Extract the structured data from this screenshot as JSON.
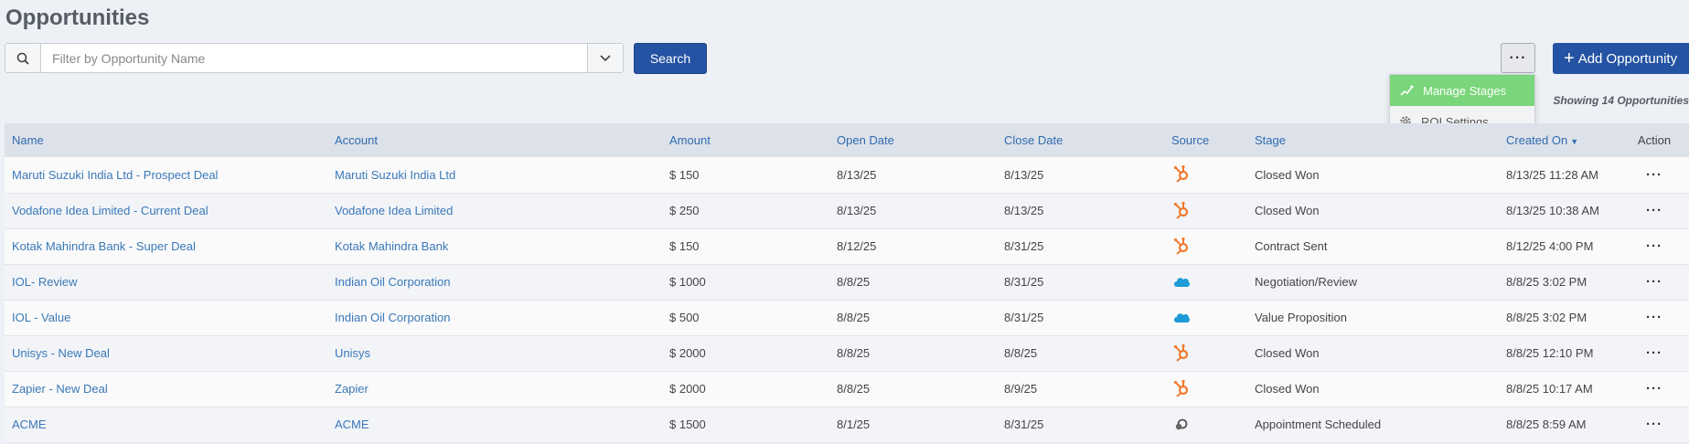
{
  "page": {
    "title": "Opportunities"
  },
  "search": {
    "placeholder": "Filter by Opportunity Name",
    "button_label": "Search"
  },
  "toolbar": {
    "more_label": "···",
    "add_label": "Add Opportunity"
  },
  "menu": {
    "items": [
      {
        "label": "Manage Stages",
        "icon": "stages-icon"
      },
      {
        "label": "ROI Settings",
        "icon": "gear-icon"
      }
    ]
  },
  "summary": {
    "showing": "Showing 14 Opportunities"
  },
  "table": {
    "headers": [
      "Name",
      "Account",
      "Amount",
      "Open Date",
      "Close Date",
      "Source",
      "Stage",
      "Created On",
      "Action"
    ],
    "rows": [
      {
        "name": "Maruti Suzuki India Ltd - Prospect Deal",
        "account": "Maruti Suzuki India Ltd",
        "amount": "$ 150",
        "open": "8/13/25",
        "close": "8/13/25",
        "source": "hubspot-icon",
        "stage": "Closed Won",
        "created": "8/13/25 11:28 AM",
        "action": "···"
      },
      {
        "name": "Vodafone Idea Limited - Current Deal",
        "account": "Vodafone Idea Limited",
        "amount": "$ 250",
        "open": "8/13/25",
        "close": "8/13/25",
        "source": "hubspot-icon",
        "stage": "Closed Won",
        "created": "8/13/25 10:38 AM",
        "action": "···"
      },
      {
        "name": "Kotak Mahindra Bank - Super Deal",
        "account": "Kotak Mahindra Bank",
        "amount": "$ 150",
        "open": "8/12/25",
        "close": "8/31/25",
        "source": "hubspot-icon",
        "stage": "Contract Sent",
        "created": "8/12/25 4:00 PM",
        "action": "···"
      },
      {
        "name": "IOL- Review",
        "account": "Indian Oil Corporation",
        "amount": "$ 1000",
        "open": "8/8/25",
        "close": "8/31/25",
        "source": "salesforce-icon",
        "stage": "Negotiation/Review",
        "created": "8/8/25 3:02 PM",
        "action": "···"
      },
      {
        "name": "IOL - Value",
        "account": "Indian Oil Corporation",
        "amount": "$ 500",
        "open": "8/8/25",
        "close": "8/31/25",
        "source": "salesforce-icon",
        "stage": "Value Proposition",
        "created": "8/8/25 3:02 PM",
        "action": "···"
      },
      {
        "name": "Unisys - New Deal",
        "account": "Unisys",
        "amount": "$ 2000",
        "open": "8/8/25",
        "close": "8/8/25",
        "source": "hubspot-icon",
        "stage": "Closed Won",
        "created": "8/8/25 12:10 PM",
        "action": "···"
      },
      {
        "name": "Zapier - New Deal",
        "account": "Zapier",
        "amount": "$ 2000",
        "open": "8/8/25",
        "close": "8/9/25",
        "source": "hubspot-icon",
        "stage": "Closed Won",
        "created": "8/8/25 10:17 AM",
        "action": "···"
      },
      {
        "name": "ACME",
        "account": "ACME",
        "amount": "$ 1500",
        "open": "8/1/25",
        "close": "8/31/25",
        "source": "manual-icon",
        "stage": "Appointment Scheduled",
        "created": "8/8/25 8:59 AM",
        "action": "···"
      }
    ]
  },
  "colors": {
    "primary": "#2553a3",
    "link": "#3a78b8",
    "menu_active": "#7ad67a",
    "hubspot": "#f07a2e",
    "salesforce": "#1d9bd7"
  }
}
